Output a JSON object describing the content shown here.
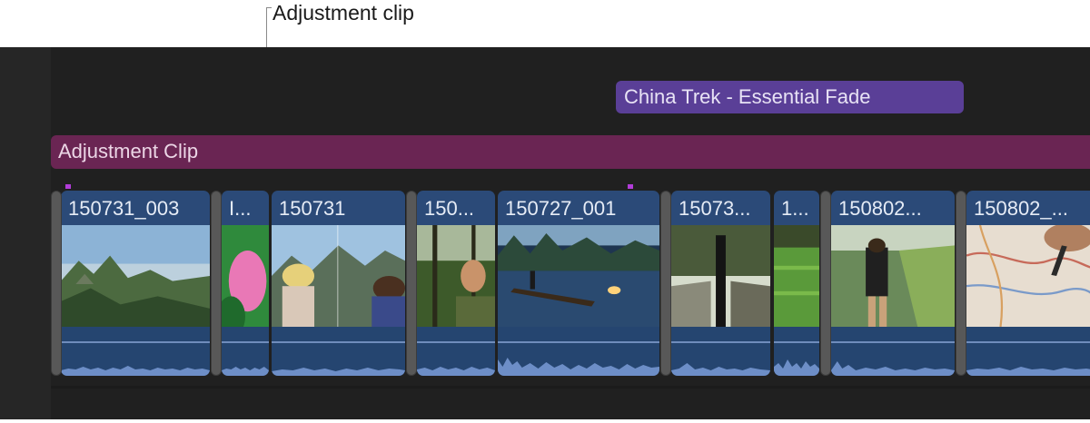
{
  "callout": {
    "label": "Adjustment clip"
  },
  "timeline": {
    "connected_title": {
      "label": "China Trek - Essential Fade"
    },
    "adjustment_clip": {
      "label": "Adjustment Clip"
    },
    "clips": [
      {
        "name": "150731_003",
        "thumbnail": "mountain-vista"
      },
      {
        "name": "I...",
        "thumbnail": "pink-lotus"
      },
      {
        "name": "150731",
        "thumbnail": "woman-mountains"
      },
      {
        "name": "150...",
        "thumbnail": "man-forest"
      },
      {
        "name": "150727_001",
        "thumbnail": "river-raft"
      },
      {
        "name": "15073...",
        "thumbnail": "forest-path"
      },
      {
        "name": "1...",
        "thumbnail": "rice-field"
      },
      {
        "name": "150802...",
        "thumbnail": "hikers"
      },
      {
        "name": "150802_...",
        "thumbnail": "map"
      }
    ]
  },
  "colors": {
    "adjustment_clip": "#6a2553",
    "connected_title": "#5a3f97",
    "primary_clip": "#2b4a78",
    "marker": "#b23cd8",
    "timeline_background": "#202020"
  }
}
